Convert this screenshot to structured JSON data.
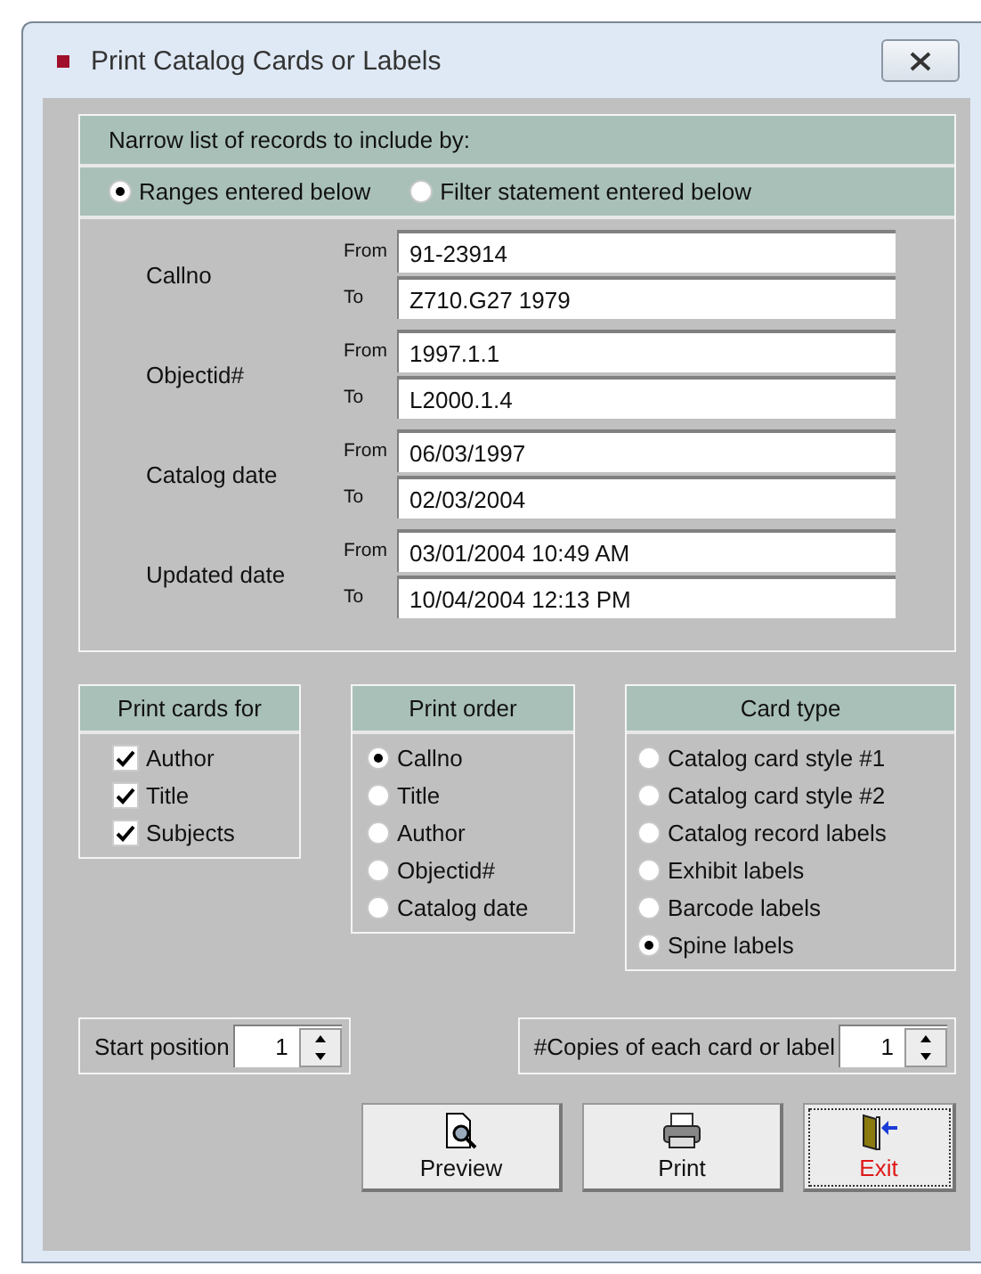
{
  "window": {
    "title": "Print Catalog Cards or Labels"
  },
  "narrow": {
    "heading": "Narrow list of records to include by:",
    "modes": [
      {
        "label": "Ranges entered below",
        "selected": true
      },
      {
        "label": "Filter statement entered below",
        "selected": false
      }
    ],
    "ranges": [
      {
        "label": "Callno",
        "from_label": "From",
        "from": "91-23914",
        "to_label": "To",
        "to": "Z710.G27 1979"
      },
      {
        "label": "Objectid#",
        "from_label": "From",
        "from": "1997.1.1",
        "to_label": "To",
        "to": "L2000.1.4"
      },
      {
        "label": "Catalog date",
        "from_label": "From",
        "from": "06/03/1997",
        "to_label": "To",
        "to": "02/03/2004"
      },
      {
        "label": "Updated date",
        "from_label": "From",
        "from": "03/01/2004 10:49 AM",
        "to_label": "To",
        "to": "10/04/2004 12:13 PM"
      }
    ]
  },
  "print_cards_for": {
    "heading": "Print cards for",
    "items": [
      {
        "label": "Author",
        "checked": true
      },
      {
        "label": "Title",
        "checked": true
      },
      {
        "label": "Subjects",
        "checked": true
      }
    ]
  },
  "print_order": {
    "heading": "Print order",
    "items": [
      {
        "label": "Callno",
        "selected": true
      },
      {
        "label": "Title",
        "selected": false
      },
      {
        "label": "Author",
        "selected": false
      },
      {
        "label": "Objectid#",
        "selected": false
      },
      {
        "label": "Catalog date",
        "selected": false
      }
    ]
  },
  "card_type": {
    "heading": "Card type",
    "items": [
      {
        "label": "Catalog card style #1",
        "selected": false
      },
      {
        "label": "Catalog card style #2",
        "selected": false
      },
      {
        "label": "Catalog record labels",
        "selected": false
      },
      {
        "label": "Exhibit labels",
        "selected": false
      },
      {
        "label": "Barcode labels",
        "selected": false
      },
      {
        "label": "Spine labels",
        "selected": true
      }
    ]
  },
  "start_position": {
    "label": "Start position",
    "value": "1"
  },
  "copies": {
    "label": "#Copies of each card or label",
    "value": "1"
  },
  "buttons": [
    {
      "kind": "preview",
      "label": "Preview"
    },
    {
      "kind": "print",
      "label": "Print"
    },
    {
      "kind": "exit",
      "label": "Exit"
    }
  ]
}
